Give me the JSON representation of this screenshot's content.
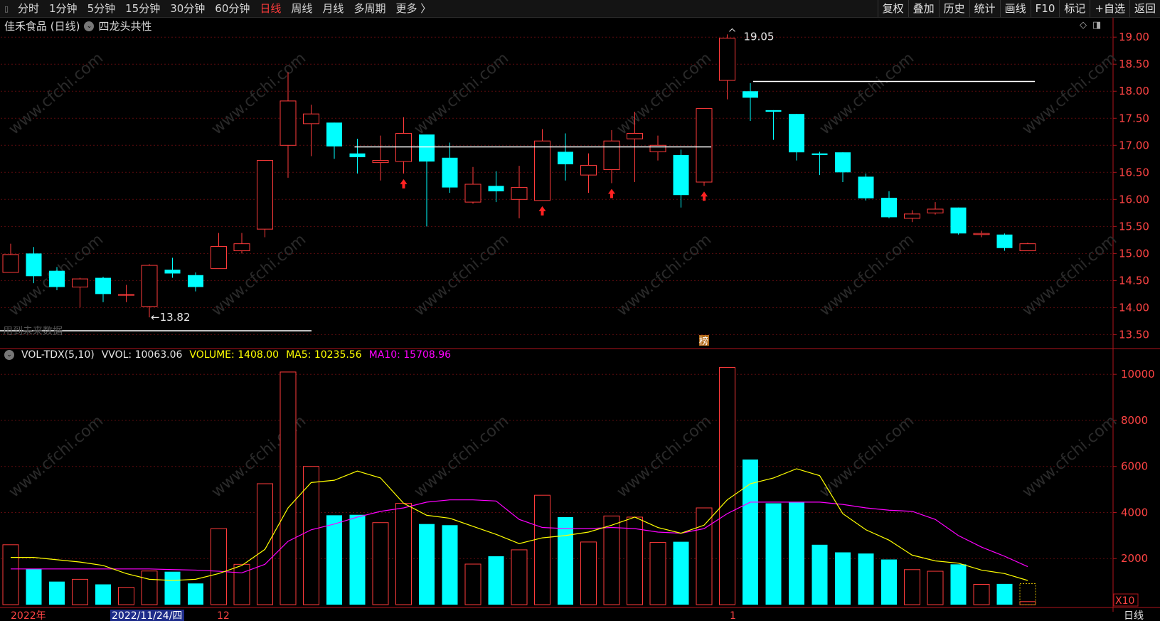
{
  "toolbar": {
    "periods": [
      "分时",
      "1分钟",
      "5分钟",
      "15分钟",
      "30分钟",
      "60分钟",
      "日线",
      "周线",
      "月线",
      "多周期",
      "更多 〉"
    ],
    "active_period": "日线",
    "right_buttons": [
      "复权",
      "叠加",
      "历史",
      "统计",
      "画线",
      "F10",
      "标记",
      "+自选",
      "返回"
    ]
  },
  "title": {
    "stock": "佳禾食品 (日线)",
    "indicator": "四龙头共性"
  },
  "chart_data": [
    {
      "type": "candlestick",
      "y_ticks": [
        "19.00",
        "18.50",
        "18.00",
        "17.50",
        "17.00",
        "16.50",
        "16.00",
        "15.50",
        "15.00",
        "14.50",
        "14.00",
        "13.50"
      ],
      "ylim": [
        13.4,
        19.2
      ],
      "candles": [
        {
          "open": 14.65,
          "close": 14.98,
          "high": 15.18,
          "low": 14.65
        },
        {
          "open": 15.0,
          "close": 14.58,
          "high": 15.12,
          "low": 14.45
        },
        {
          "open": 14.68,
          "close": 14.38,
          "high": 14.75,
          "low": 14.32
        },
        {
          "open": 14.38,
          "close": 14.53,
          "high": 14.55,
          "low": 14.0
        },
        {
          "open": 14.55,
          "close": 14.25,
          "high": 14.57,
          "low": 14.1
        },
        {
          "open": 14.24,
          "close": 14.24,
          "high": 14.42,
          "low": 14.1
        },
        {
          "open": 14.02,
          "close": 14.78,
          "high": 14.8,
          "low": 13.82
        },
        {
          "open": 14.7,
          "close": 14.63,
          "high": 14.92,
          "low": 14.55
        },
        {
          "open": 14.6,
          "close": 14.38,
          "high": 14.65,
          "low": 14.3
        },
        {
          "open": 14.72,
          "close": 15.13,
          "high": 15.38,
          "low": 14.72
        },
        {
          "open": 15.05,
          "close": 15.18,
          "high": 15.38,
          "low": 15.0
        },
        {
          "open": 15.45,
          "close": 16.72,
          "high": 16.72,
          "low": 15.3
        },
        {
          "open": 17.0,
          "close": 17.82,
          "high": 18.35,
          "low": 16.4
        },
        {
          "open": 17.4,
          "close": 17.58,
          "high": 17.75,
          "low": 16.8
        },
        {
          "open": 17.42,
          "close": 16.98,
          "high": 17.42,
          "low": 16.75
        },
        {
          "open": 16.85,
          "close": 16.78,
          "high": 17.12,
          "low": 16.48
        },
        {
          "open": 16.68,
          "close": 16.72,
          "high": 17.18,
          "low": 16.35
        },
        {
          "open": 16.7,
          "close": 17.22,
          "high": 17.52,
          "low": 16.48
        },
        {
          "open": 17.2,
          "close": 16.7,
          "high": 17.2,
          "low": 15.5
        },
        {
          "open": 16.77,
          "close": 16.22,
          "high": 17.05,
          "low": 16.12
        },
        {
          "open": 15.95,
          "close": 16.28,
          "high": 16.6,
          "low": 15.92
        },
        {
          "open": 16.25,
          "close": 16.15,
          "high": 16.52,
          "low": 15.95
        },
        {
          "open": 16.0,
          "close": 16.22,
          "high": 16.62,
          "low": 15.65
        },
        {
          "open": 15.98,
          "close": 17.08,
          "high": 17.3,
          "low": 15.98
        },
        {
          "open": 16.88,
          "close": 16.65,
          "high": 17.22,
          "low": 16.35
        },
        {
          "open": 16.45,
          "close": 16.63,
          "high": 16.85,
          "low": 16.12
        },
        {
          "open": 16.55,
          "close": 17.08,
          "high": 17.28,
          "low": 16.3
        },
        {
          "open": 17.12,
          "close": 17.22,
          "high": 17.62,
          "low": 16.32
        },
        {
          "open": 16.88,
          "close": 17.0,
          "high": 17.18,
          "low": 16.72
        },
        {
          "open": 16.82,
          "close": 16.08,
          "high": 16.92,
          "low": 15.85
        },
        {
          "open": 16.32,
          "close": 17.68,
          "high": 17.68,
          "low": 16.25
        },
        {
          "open": 18.2,
          "close": 18.98,
          "high": 19.05,
          "low": 17.85
        },
        {
          "open": 18.0,
          "close": 17.88,
          "high": 18.15,
          "low": 17.45
        },
        {
          "open": 17.65,
          "close": 17.62,
          "high": 17.65,
          "low": 17.1
        },
        {
          "open": 17.58,
          "close": 16.87,
          "high": 17.58,
          "low": 16.72
        },
        {
          "open": 16.85,
          "close": 16.82,
          "high": 16.88,
          "low": 16.45
        },
        {
          "open": 16.87,
          "close": 16.5,
          "high": 16.87,
          "low": 16.32
        },
        {
          "open": 16.42,
          "close": 16.02,
          "high": 16.48,
          "low": 15.98
        },
        {
          "open": 16.03,
          "close": 15.67,
          "high": 16.15,
          "low": 15.65
        },
        {
          "open": 15.65,
          "close": 15.73,
          "high": 15.8,
          "low": 15.58
        },
        {
          "open": 15.75,
          "close": 15.82,
          "high": 15.95,
          "low": 15.72
        },
        {
          "open": 15.85,
          "close": 15.37,
          "high": 15.85,
          "low": 15.35
        },
        {
          "open": 15.35,
          "close": 15.37,
          "high": 15.42,
          "low": 15.3
        },
        {
          "open": 15.35,
          "close": 15.1,
          "high": 15.37,
          "low": 15.05
        },
        {
          "open": 15.05,
          "close": 15.18,
          "high": 15.2,
          "low": 15.05
        }
      ],
      "annotations": {
        "high_label": "19.05",
        "low_label": "←13.82",
        "left_note": "用到未来数据",
        "marker": "榜"
      },
      "signal_arrow_candles": [
        17,
        23,
        26,
        30
      ]
    },
    {
      "type": "bar",
      "indicator": "VOL-TDX(5,10)",
      "legend": {
        "vvol": "VVOL: 10063.06",
        "volume": "VOLUME: 1408.00",
        "ma5": "MA5: 10235.56",
        "ma10": "MA10: 15708.96"
      },
      "colors": {
        "up": "#ff3b3b",
        "down": "#00ffff",
        "ma5": "#ffff00",
        "ma10": "#ff00ff",
        "vvol": "#e6e6e6"
      },
      "y_ticks": [
        2000,
        4000,
        6000,
        8000,
        10000
      ],
      "ylim": [
        0,
        10500
      ],
      "unit_label": "X10",
      "volumes": [
        2600,
        1550,
        1000,
        1100,
        880,
        750,
        1460,
        1430,
        920,
        3300,
        1750,
        5250,
        10100,
        6000,
        3880,
        3900,
        3560,
        4400,
        3500,
        3450,
        1760,
        2100,
        2380,
        4750,
        3800,
        2720,
        3850,
        3800,
        2700,
        2730,
        4200,
        10300,
        6300,
        4400,
        4450,
        2600,
        2270,
        2220,
        1960,
        1520,
        1450,
        1750,
        880,
        900,
        130
      ],
      "ma5": [
        2050,
        2050,
        1950,
        1850,
        1700,
        1350,
        1100,
        1050,
        1100,
        1350,
        1700,
        2400,
        4200,
        5300,
        5400,
        5800,
        5500,
        4400,
        3880,
        3750,
        3400,
        3050,
        2650,
        2900,
        3000,
        3150,
        3450,
        3800,
        3350,
        3100,
        3450,
        4550,
        5250,
        5500,
        5900,
        5600,
        3950,
        3250,
        2800,
        2150,
        1900,
        1800,
        1500,
        1350,
        1050
      ],
      "ma10": [
        1550,
        1550,
        1550,
        1550,
        1550,
        1550,
        1550,
        1520,
        1500,
        1450,
        1380,
        1750,
        2750,
        3250,
        3500,
        3800,
        4050,
        4200,
        4450,
        4550,
        4550,
        4500,
        3700,
        3350,
        3300,
        3300,
        3350,
        3300,
        3150,
        3100,
        3300,
        3950,
        4450,
        4450,
        4450,
        4450,
        4350,
        4200,
        4100,
        4050,
        3700,
        3000,
        2500,
        2100,
        1650
      ]
    }
  ],
  "x_axis": {
    "labels": [
      "2022年",
      "2022/11/24/四",
      "12",
      "1"
    ]
  },
  "status": {
    "period_label": "日线"
  }
}
